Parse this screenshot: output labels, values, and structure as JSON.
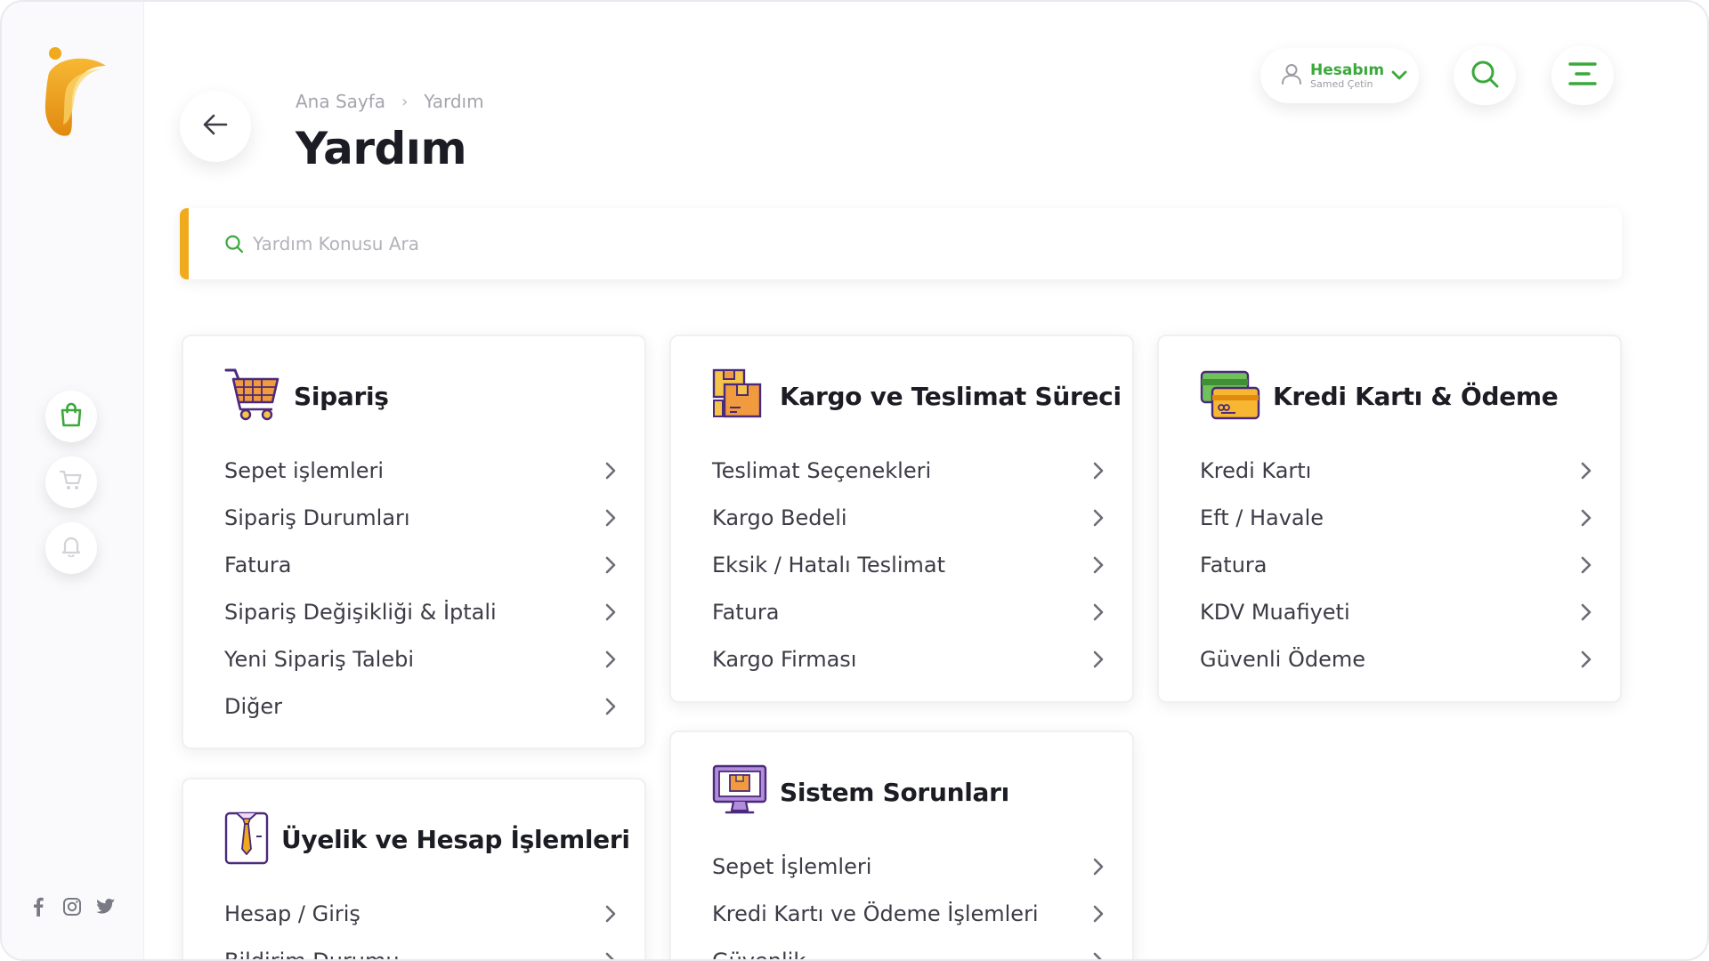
{
  "breadcrumb": {
    "home": "Ana Sayfa",
    "separator": "›",
    "current": "Yardım"
  },
  "page_title": "Yardım",
  "account": {
    "title": "Hesabım",
    "user": "Samed Çetin"
  },
  "search": {
    "placeholder": "Yardım Konusu Ara"
  },
  "sidebar": {
    "buttons": [
      "bag-icon",
      "cart-icon",
      "bell-icon"
    ],
    "socials": [
      "facebook-icon",
      "instagram-icon",
      "twitter-icon"
    ]
  },
  "colors": {
    "accent": "#f0aa1e",
    "brand_green": "#3aa93a",
    "text_dark": "#1c1c24",
    "text_muted": "#a4a4ad"
  },
  "cards": {
    "siparis": {
      "title": "Sipariş",
      "icon": "shopping-cart-icon",
      "items": [
        "Sepet işlemleri",
        "Sipariş Durumları",
        "Fatura",
        "Sipariş Değişikliği & İptali",
        "Yeni Sipariş Talebi",
        "Diğer"
      ]
    },
    "kargo": {
      "title": "Kargo ve Teslimat Süreci",
      "icon": "package-boxes-icon",
      "items": [
        "Teslimat Seçenekleri",
        "Kargo Bedeli",
        "Eksik / Hatalı Teslimat",
        "Fatura",
        "Kargo Firması"
      ]
    },
    "kredi": {
      "title": "Kredi Kartı & Ödeme",
      "icon": "credit-cards-icon",
      "items": [
        "Kredi Kartı",
        "Eft / Havale",
        "Fatura",
        "KDV Muafiyeti",
        "Güvenli Ödeme"
      ]
    },
    "sistem": {
      "title": "Sistem Sorunları",
      "icon": "computer-icon",
      "items": [
        "Sepet İşlemleri",
        "Kredi Kartı ve Ödeme İşlemleri",
        "Güvenlik"
      ]
    },
    "uyelik": {
      "title": "Üyelik ve Hesap İşlemleri",
      "icon": "shirt-tie-icon",
      "items": [
        "Hesap / Giriş",
        "Bildirim Durumu"
      ]
    }
  }
}
